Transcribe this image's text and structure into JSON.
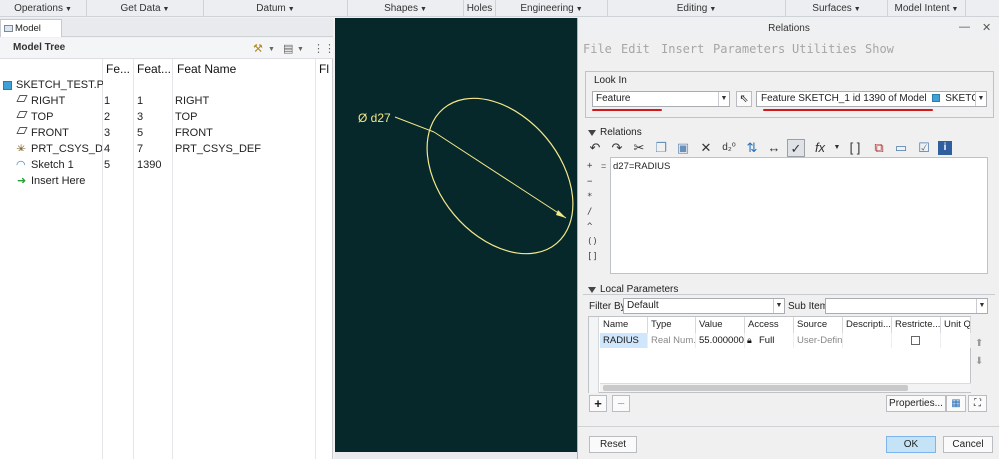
{
  "ribbon": {
    "groups": [
      {
        "label": "Operations"
      },
      {
        "label": "Get Data"
      },
      {
        "label": "Datum"
      },
      {
        "label": "Shapes"
      },
      {
        "label": "Holes"
      },
      {
        "label": "Engineering"
      },
      {
        "label": "Editing"
      },
      {
        "label": "Surfaces"
      },
      {
        "label": "Model Intent"
      }
    ]
  },
  "model_tree": {
    "tab_label": "Model Tree",
    "title": "Model Tree",
    "columns": [
      "Fe...",
      "Feat...",
      "Feat Name",
      "Fl"
    ],
    "root": {
      "name": "SKETCH_TEST.PI"
    },
    "rows": [
      {
        "name": "RIGHT",
        "fe": "1",
        "feat": "1",
        "feat_name": "RIGHT",
        "icon": "datum-plane-icon"
      },
      {
        "name": "TOP",
        "fe": "2",
        "feat": "3",
        "feat_name": "TOP",
        "icon": "datum-plane-icon"
      },
      {
        "name": "FRONT",
        "fe": "3",
        "feat": "5",
        "feat_name": "FRONT",
        "icon": "datum-plane-icon"
      },
      {
        "name": "PRT_CSYS_DEF",
        "fe": "4",
        "feat": "7",
        "feat_name": "PRT_CSYS_DEF",
        "icon": "csys-icon"
      },
      {
        "name": "Sketch 1",
        "fe": "5",
        "feat": "1390",
        "feat_name": "",
        "icon": "sketch-icon"
      }
    ],
    "insert_here": "Insert Here"
  },
  "canvas": {
    "dimension_label": "Ø d27"
  },
  "dialog": {
    "title": "Relations",
    "menu": [
      "File",
      "Edit",
      "Insert",
      "Parameters",
      "Utilities",
      "Show"
    ],
    "look_in": {
      "label": "Look In",
      "type_value": "Feature",
      "feature_value": "Feature SKETCH_1 id 1390 of Model",
      "model_value": "SKETCH_TEST"
    },
    "relations": {
      "label": "Relations",
      "text": "d27=RADIUS",
      "side_ops": [
        "+",
        "−",
        "*",
        "/",
        "^",
        "()",
        "[]"
      ]
    },
    "local_params": {
      "label": "Local Parameters",
      "filter_label": "Filter By",
      "filter_value": "Default",
      "subitems_label": "Sub Items",
      "subitems_value": "",
      "columns": [
        "Name",
        "Type",
        "Value",
        "Access",
        "Source",
        "Descripti...",
        "Restricte...",
        "Unit Qu"
      ],
      "rows": [
        {
          "name": "RADIUS",
          "type": "Real Num...",
          "value": "55.000000",
          "access": "Full",
          "source": "User-Defin...",
          "description": "",
          "restricted": false,
          "unit": ""
        }
      ],
      "properties_button": "Properties..."
    },
    "buttons": {
      "reset": "Reset",
      "ok": "OK",
      "cancel": "Cancel"
    }
  }
}
